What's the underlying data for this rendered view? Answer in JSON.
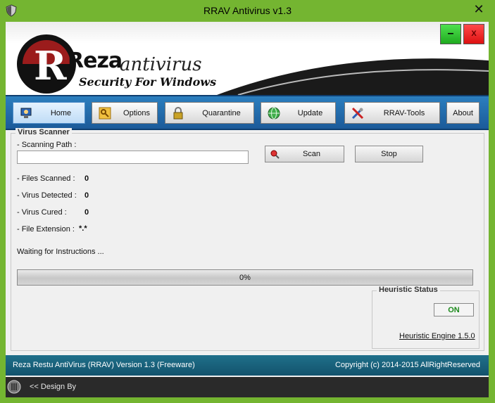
{
  "window": {
    "title": "RRAV Antivirus v1.3"
  },
  "banner": {
    "brand": "Reza",
    "brand_sub": "antivirus",
    "tagline": "Security For Windows",
    "minimize_label": "–",
    "close_label": "X"
  },
  "nav": {
    "items": [
      {
        "label": "Home",
        "icon": "monitor-user-icon"
      },
      {
        "label": "Options",
        "icon": "key-icon"
      },
      {
        "label": "Quarantine",
        "icon": "lock-icon"
      },
      {
        "label": "Update",
        "icon": "globe-icon"
      },
      {
        "label": "RRAV-Tools",
        "icon": "tools-icon"
      },
      {
        "label": "About",
        "icon": ""
      }
    ],
    "active": "Home"
  },
  "scanner": {
    "group_title": "Virus Scanner",
    "scanning_path_label": "- Scanning Path  :",
    "scanning_path_value": "",
    "scan_label": "Scan",
    "stop_label": "Stop",
    "files_scanned_label": "- Files Scanned   :",
    "files_scanned": "0",
    "virus_detected_label": "- Virus Detected  :",
    "virus_detected": "0",
    "virus_cured_label": "- Virus Cured      :",
    "virus_cured": "0",
    "file_extension_label": "- File Extension  :",
    "file_extension": "*.*",
    "status_text": "Waiting for Instructions ...",
    "progress_text": "0%",
    "progress": 0
  },
  "heuristic": {
    "title": "Heuristic Status",
    "state": "ON",
    "engine": "Heuristic Engine 1.5.0"
  },
  "statusbar": {
    "left": "Reza Restu AntiVirus (RRAV) Version 1.3 (Freeware)",
    "right": "Copyright (c) 2014-2015 AllRightReserved"
  },
  "footer": {
    "design_by": "<< Design By"
  },
  "colors": {
    "frame": "#74b531",
    "nav": "#2c7fbf",
    "status": "#1f6f8a",
    "on": "#1c8a1c"
  }
}
